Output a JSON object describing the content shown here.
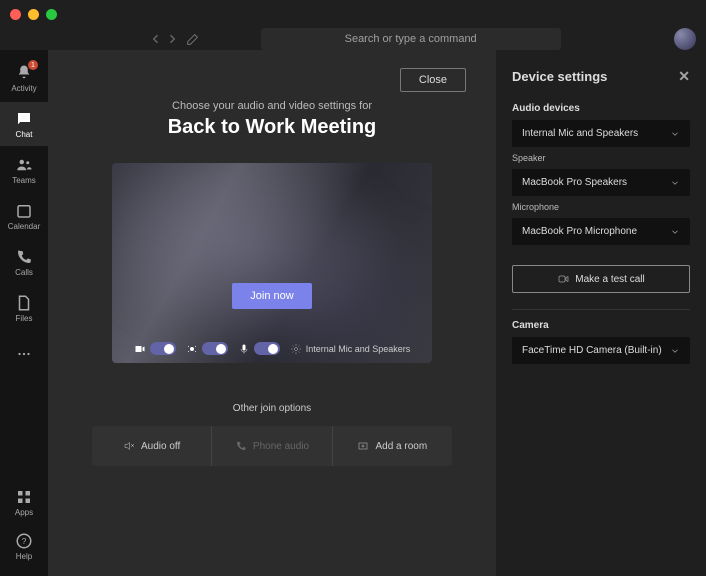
{
  "titlebar": {
    "search_placeholder": "Search or type a command"
  },
  "rail": {
    "items": [
      {
        "label": "Activity",
        "badge": "1"
      },
      {
        "label": "Chat"
      },
      {
        "label": "Teams"
      },
      {
        "label": "Calendar"
      },
      {
        "label": "Calls"
      },
      {
        "label": "Files"
      }
    ],
    "apps": "Apps",
    "help": "Help"
  },
  "main": {
    "close": "Close",
    "subtitle": "Choose your audio and video settings for",
    "meeting_title": "Back to Work Meeting",
    "join": "Join now",
    "device_summary": "Internal Mic and Speakers",
    "other_label": "Other join options",
    "options": {
      "audio_off": "Audio off",
      "phone_audio": "Phone audio",
      "add_room": "Add a room"
    }
  },
  "panel": {
    "title": "Device settings",
    "audio_devices_label": "Audio devices",
    "audio_device": "Internal Mic and Speakers",
    "speaker_label": "Speaker",
    "speaker": "MacBook Pro Speakers",
    "mic_label": "Microphone",
    "mic": "MacBook Pro Microphone",
    "test_call": "Make a test call",
    "camera_label": "Camera",
    "camera": "FaceTime HD Camera (Built-in)"
  }
}
